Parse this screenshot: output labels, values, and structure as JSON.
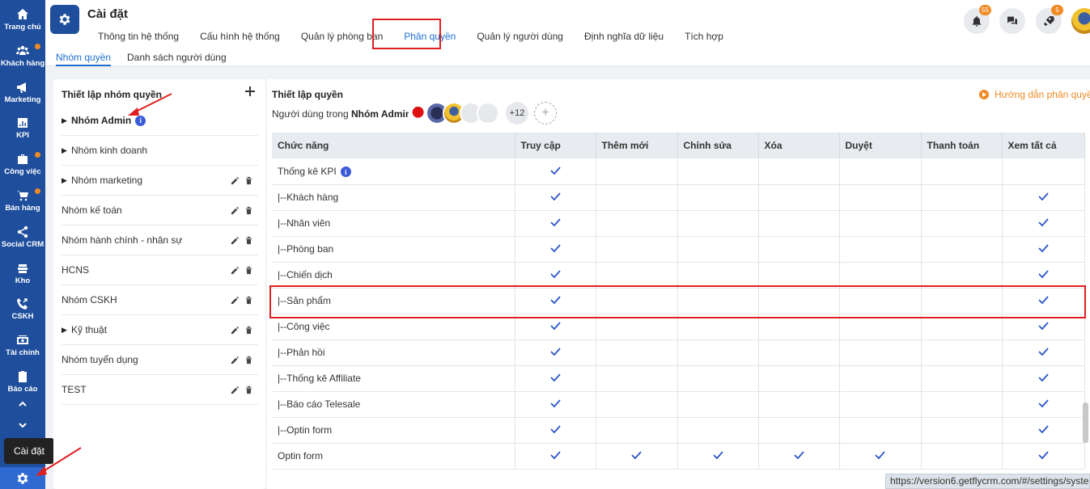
{
  "sidebar": {
    "items": [
      {
        "label": "Trang chủ",
        "icon": "home-icon",
        "dot": false
      },
      {
        "label": "Khách hàng",
        "icon": "people-icon",
        "dot": true
      },
      {
        "label": "Marketing",
        "icon": "megaphone-icon",
        "dot": false
      },
      {
        "label": "KPI",
        "icon": "bar-chart-icon",
        "dot": false
      },
      {
        "label": "Công việc",
        "icon": "briefcase-icon",
        "dot": true
      },
      {
        "label": "Bán hàng",
        "icon": "cart-icon",
        "dot": true
      },
      {
        "label": "Social CRM",
        "icon": "share-icon",
        "dot": false
      },
      {
        "label": "Kho",
        "icon": "warehouse-icon",
        "dot": false
      },
      {
        "label": "CSKH",
        "icon": "phone-icon",
        "dot": false
      },
      {
        "label": "Tài chính",
        "icon": "money-icon",
        "dot": false
      },
      {
        "label": "Báo cáo",
        "icon": "clipboard-icon",
        "dot": false
      }
    ],
    "tooltip": "Cài đặt"
  },
  "header": {
    "title": "Cài đặt",
    "tabs": [
      "Thông tin hệ thống",
      "Cấu hình hệ thống",
      "Quản lý phòng ban",
      "Phân quyền",
      "Quản lý người dùng",
      "Định nghĩa dữ liệu",
      "Tích hợp"
    ],
    "active_tab": "Phân quyền",
    "notifications_badge": "55",
    "rocket_badge": "5"
  },
  "subtabs": {
    "groups": "Nhóm quyền",
    "users": "Danh sách người dùng"
  },
  "left": {
    "title": "Thiết lập nhóm quyền",
    "groups": [
      {
        "name": "Nhóm Admin",
        "caret": true,
        "bold": true,
        "info": true,
        "actions": false
      },
      {
        "name": "Nhóm kinh doanh",
        "caret": true,
        "bold": false,
        "info": false,
        "actions": false
      },
      {
        "name": "Nhóm marketing",
        "caret": true,
        "bold": false,
        "info": false,
        "actions": true
      },
      {
        "name": "Nhóm kế toán",
        "caret": false,
        "bold": false,
        "info": false,
        "actions": true
      },
      {
        "name": "Nhóm hành chính - nhân sự",
        "caret": false,
        "bold": false,
        "info": false,
        "actions": true
      },
      {
        "name": "HCNS",
        "caret": false,
        "bold": false,
        "info": false,
        "actions": true
      },
      {
        "name": "Nhóm CSKH",
        "caret": false,
        "bold": false,
        "info": false,
        "actions": true
      },
      {
        "name": "Kỹ thuật",
        "caret": true,
        "bold": false,
        "info": false,
        "actions": true
      },
      {
        "name": "Nhóm tuyển dụng",
        "caret": false,
        "bold": false,
        "info": false,
        "actions": true
      },
      {
        "name": "TEST",
        "caret": false,
        "bold": false,
        "info": false,
        "actions": true
      }
    ]
  },
  "right": {
    "title": "Thiết lập quyền",
    "guide": "Hướng dẫn phân quyền",
    "users_prefix": "Người dùng trong",
    "users_group": "Nhóm Admin:",
    "more_users": "+12",
    "add_user": "+",
    "columns": [
      "Chức năng",
      "Truy cập",
      "Thêm mới",
      "Chỉnh sửa",
      "Xóa",
      "Duyệt",
      "Thanh toán",
      "Xem tất cả"
    ],
    "rows": [
      {
        "name": "Thống kê KPI",
        "info": true,
        "checks": [
          true,
          false,
          false,
          false,
          false,
          false,
          false
        ]
      },
      {
        "name": "|--Khách hàng",
        "info": false,
        "checks": [
          true,
          false,
          false,
          false,
          false,
          false,
          true
        ]
      },
      {
        "name": "|--Nhân viên",
        "info": false,
        "checks": [
          true,
          false,
          false,
          false,
          false,
          false,
          true
        ]
      },
      {
        "name": "|--Phòng ban",
        "info": false,
        "checks": [
          true,
          false,
          false,
          false,
          false,
          false,
          true
        ]
      },
      {
        "name": "|--Chiến dịch",
        "info": false,
        "checks": [
          true,
          false,
          false,
          false,
          false,
          false,
          true
        ]
      },
      {
        "name": "|--Sản phẩm",
        "info": false,
        "checks": [
          true,
          false,
          false,
          false,
          false,
          false,
          true
        ]
      },
      {
        "name": "|--Công việc",
        "info": false,
        "checks": [
          true,
          false,
          false,
          false,
          false,
          false,
          true
        ]
      },
      {
        "name": "|--Phản hồi",
        "info": false,
        "checks": [
          true,
          false,
          false,
          false,
          false,
          false,
          true
        ]
      },
      {
        "name": "|--Thống kê Affiliate",
        "info": false,
        "checks": [
          true,
          false,
          false,
          false,
          false,
          false,
          true
        ]
      },
      {
        "name": "|--Báo cáo Telesale",
        "info": false,
        "checks": [
          true,
          false,
          false,
          false,
          false,
          false,
          true
        ]
      },
      {
        "name": "|--Optin form",
        "info": false,
        "checks": [
          true,
          false,
          false,
          false,
          false,
          false,
          true
        ]
      },
      {
        "name": "Optin form",
        "info": false,
        "checks": [
          true,
          true,
          true,
          true,
          true,
          false,
          true
        ]
      }
    ]
  },
  "status_url": "https://version6.getflycrm.com/#/settings/syste",
  "colors": {
    "sidebar": "#1f4e9c",
    "accent": "#1f6fd1",
    "highlight": "#e02020",
    "orange": "#f08a24"
  }
}
